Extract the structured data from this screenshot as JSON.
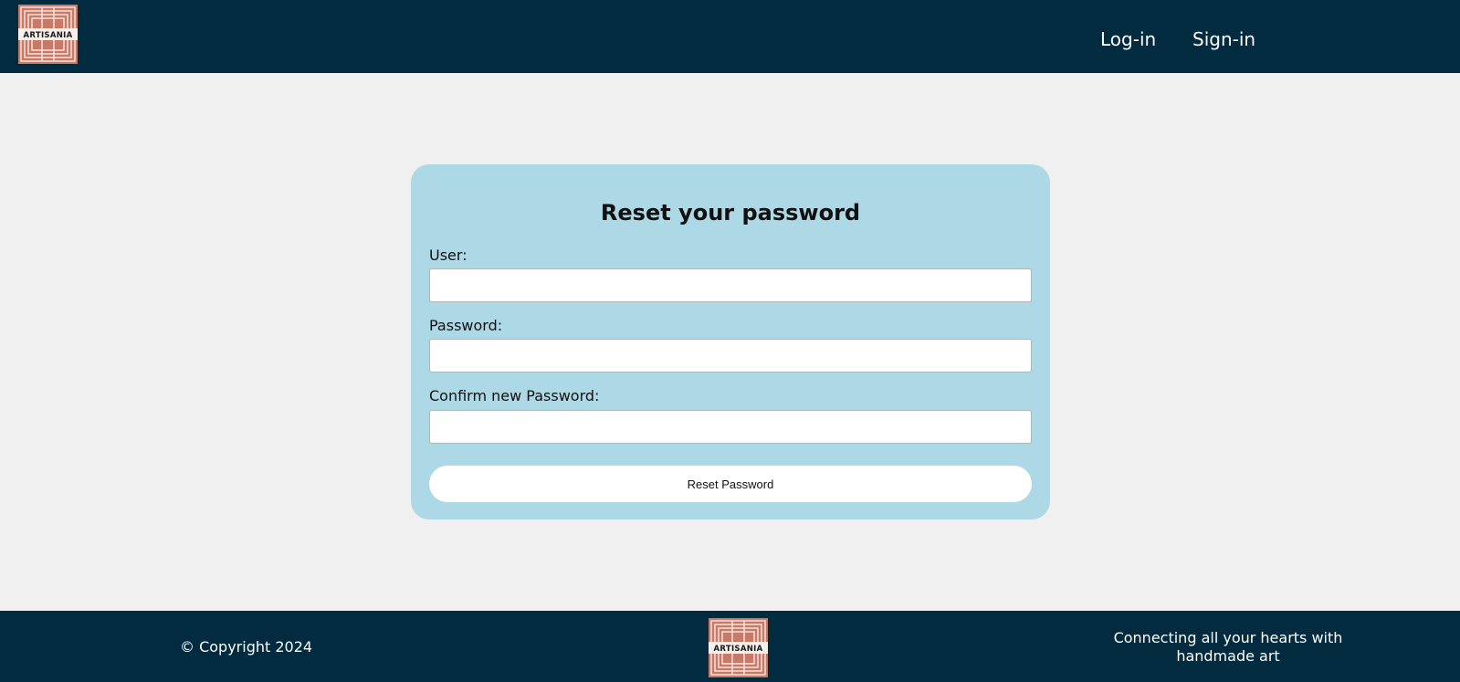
{
  "header": {
    "logo_text": "ARTISANIA",
    "nav": [
      {
        "label": "Log-in"
      },
      {
        "label": "Sign-in"
      }
    ]
  },
  "form": {
    "title": "Reset your password",
    "fields": [
      {
        "label": "User:",
        "value": ""
      },
      {
        "label": "Password:",
        "value": ""
      },
      {
        "label": "Confirm new Password:",
        "value": ""
      }
    ],
    "submit_label": "Reset Password"
  },
  "footer": {
    "copyright": "© Copyright 2024",
    "logo_text": "ARTISANIA",
    "tagline": "Connecting all your hearts with handmade art"
  },
  "colors": {
    "header_bg": "#022b3f",
    "page_bg": "#f0f0f0",
    "card_bg": "#add8e6",
    "logo_bg": "#c97a67"
  }
}
